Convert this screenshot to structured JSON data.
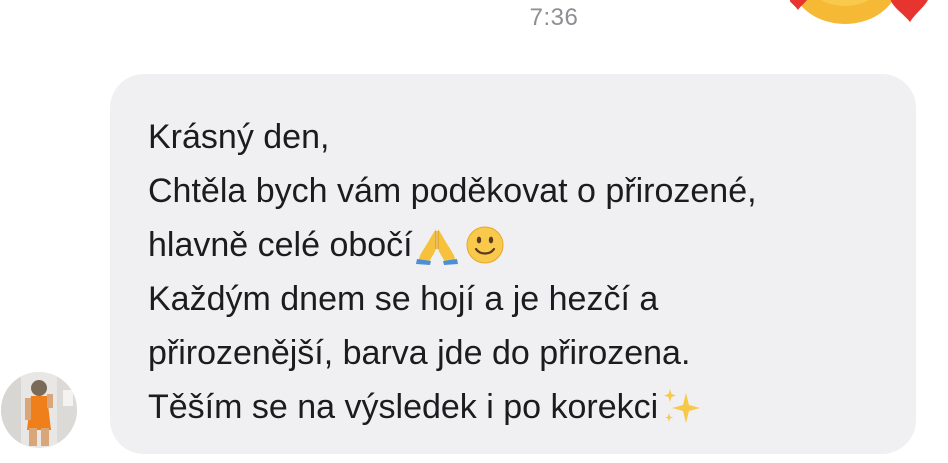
{
  "chat": {
    "timestamp": "7:36",
    "reaction": {
      "icon": "heart-eyes-emoji-icon",
      "colors": {
        "face": "#f5b935",
        "heart": "#e8342f"
      }
    },
    "sender": {
      "avatar_icon": "profile-photo"
    },
    "message": {
      "lines": [
        "Krásný den,",
        "Chtěla bych vám poděkovat o přirozené,",
        "hlavně celé obočí",
        "Každým dnem se hojí a je hezčí a",
        "přirozenější, barva jde do přirozena.",
        "Těším se na výsledek i po korekci"
      ],
      "emojis": [
        "folded-hands-icon",
        "slightly-smiling-face-icon",
        "sparkles-icon"
      ]
    }
  },
  "theme": {
    "bubble_bg": "#f0f0f3",
    "text_color": "#1c1c1e",
    "timestamp_color": "#8e8e93"
  }
}
